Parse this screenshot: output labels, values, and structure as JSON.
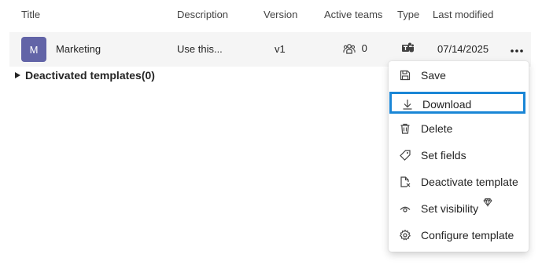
{
  "columns": {
    "title": "Title",
    "description": "Description",
    "version": "Version",
    "active_teams": "Active teams",
    "type": "Type",
    "last_modified": "Last modified"
  },
  "row": {
    "avatar_letter": "M",
    "title": "Marketing",
    "description": "Use this...",
    "version": "v1",
    "active_teams": "0",
    "type_icon": "teams-icon",
    "last_modified": "07/14/2025"
  },
  "deactivated": {
    "label": "Deactivated templates(0)"
  },
  "menu": {
    "items": [
      {
        "label": "Save",
        "icon": "save-icon"
      },
      {
        "label": "Download",
        "icon": "download-icon",
        "focused": true
      },
      {
        "label": "Delete",
        "icon": "delete-icon"
      },
      {
        "label": "Set fields",
        "icon": "tag-icon"
      },
      {
        "label": "Deactivate template",
        "icon": "deactivate-icon"
      },
      {
        "label": "Set visibility",
        "icon": "eye-icon",
        "badge_icon": "premium-diamond-icon"
      },
      {
        "label": "Configure template",
        "icon": "gear-icon"
      }
    ]
  },
  "colors": {
    "avatar": "#6264a7",
    "row_hover": "#f5f5f5",
    "focus_ring": "#1a86d6"
  }
}
